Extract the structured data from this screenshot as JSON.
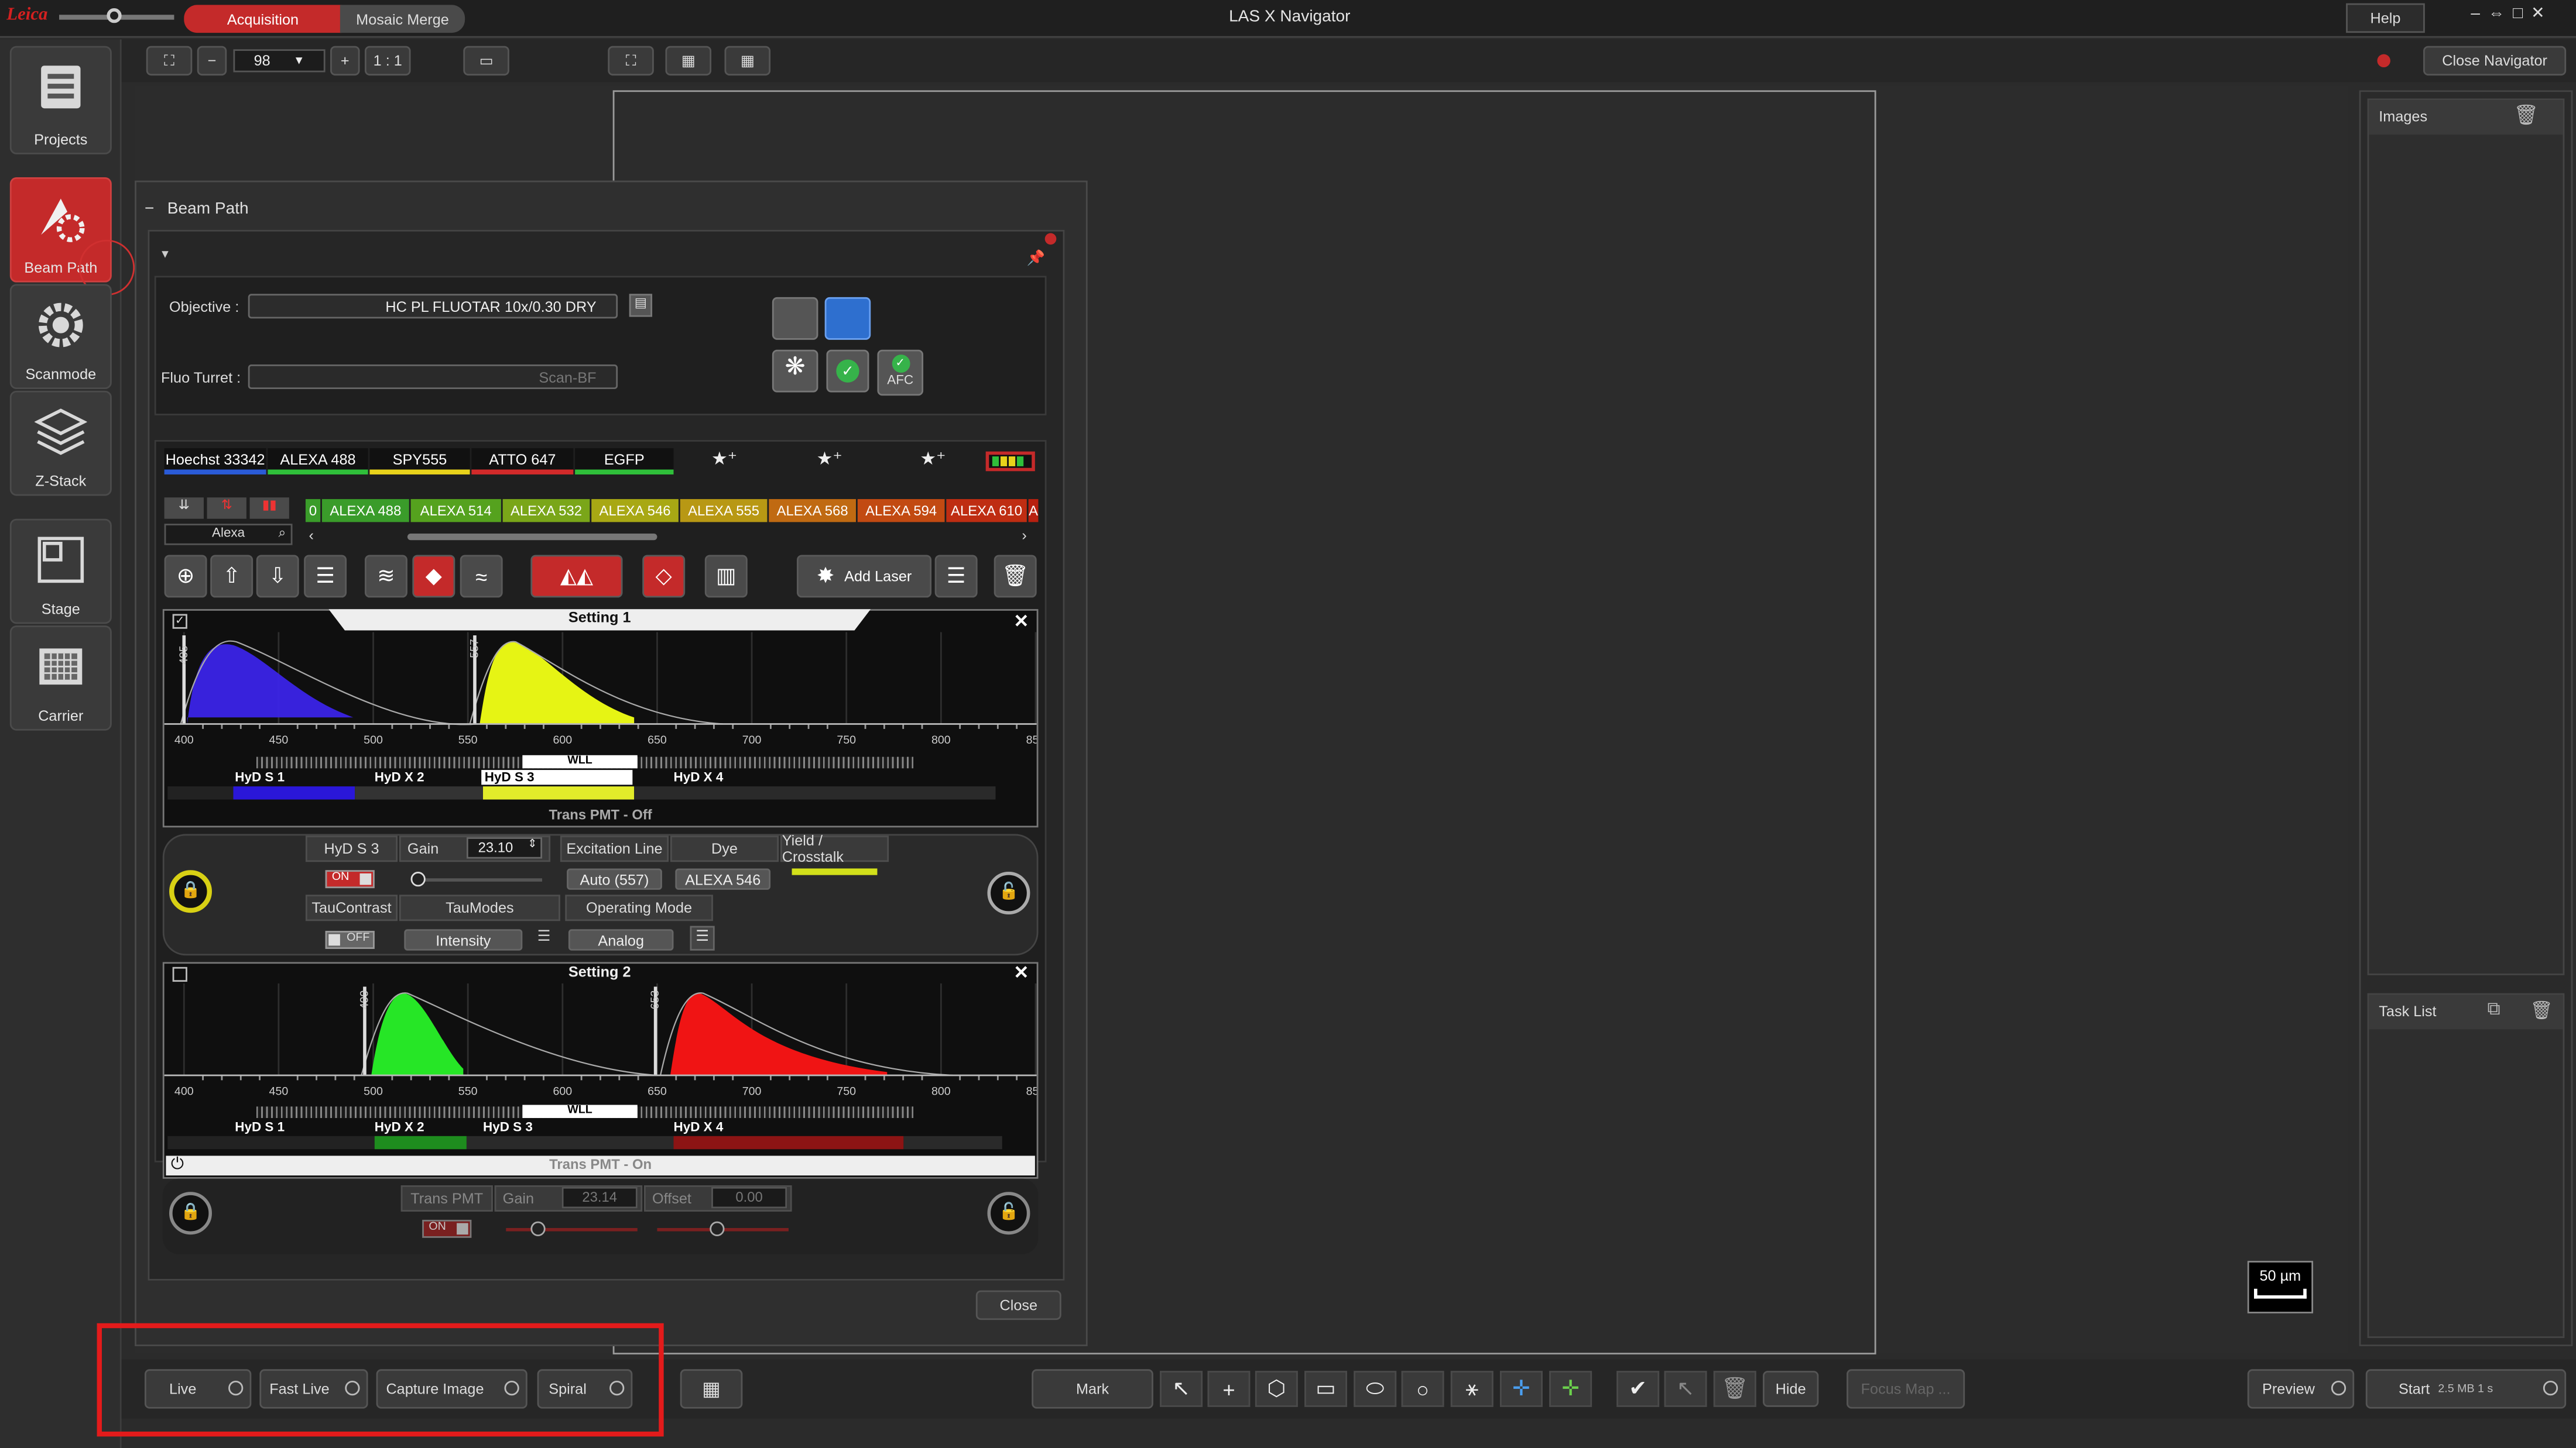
{
  "titlebar": {
    "title": "LAS X Navigator",
    "tabs": [
      "Acquisition",
      "Mosaic Merge"
    ],
    "help": "Help"
  },
  "toolbar": {
    "zoom": "98",
    "ratio": "1 : 1",
    "close_navigator": "Close Navigator"
  },
  "sidebar": [
    "Projects",
    "Beam Path",
    "Scanmode",
    "Z-Stack",
    "Stage",
    "Carrier"
  ],
  "right_panel": {
    "images": "Images",
    "task_list": "Task List"
  },
  "scale_bar": "50 µm",
  "beam_path": {
    "title": "Beam Path",
    "objective_label": "Objective :",
    "objective_value": "HC PL FLUOTAR    10x/0.30 DRY",
    "fluo_label": "Fluo Turret :",
    "fluo_value": "Scan-BF",
    "afc": "AFC",
    "dye_tabs": [
      {
        "name": "Hoechst 33342",
        "color": "#2a5bd7"
      },
      {
        "name": "ALEXA 488",
        "color": "#2fbf3a"
      },
      {
        "name": "SPY555",
        "color": "#e8d21b"
      },
      {
        "name": "ATTO 647",
        "color": "#d22a2a"
      },
      {
        "name": "EGFP",
        "color": "#2fbf3a"
      }
    ],
    "dye_chips": [
      {
        "name": "0",
        "color": "#3a9c2a"
      },
      {
        "name": "ALEXA 488",
        "color": "#3a9c2a"
      },
      {
        "name": "ALEXA 514",
        "color": "#55a21e"
      },
      {
        "name": "ALEXA 532",
        "color": "#7aa619"
      },
      {
        "name": "ALEXA 546",
        "color": "#a8a814"
      },
      {
        "name": "ALEXA 555",
        "color": "#b89814"
      },
      {
        "name": "ALEXA 568",
        "color": "#c06a12"
      },
      {
        "name": "ALEXA 594",
        "color": "#c24a12"
      },
      {
        "name": "ALEXA 610",
        "color": "#bf2d12"
      },
      {
        "name": "A",
        "color": "#b82010"
      }
    ],
    "dye_search": "Alexa",
    "add_laser": "Add Laser",
    "close": "Close",
    "axis_ticks": [
      "400",
      "450",
      "500",
      "550",
      "600",
      "650",
      "700",
      "750",
      "800",
      "850"
    ],
    "setting1": {
      "title": "Setting 1",
      "wll": "WLL",
      "lines": [
        "405",
        "557"
      ],
      "detectors": [
        "HyD S 1",
        "HyD X 2",
        "HyD S 3",
        "HyD X 4"
      ],
      "trans": "Trans PMT - Off",
      "hyd_label": "HyD S 3",
      "gain_label": "Gain",
      "gain": "23.10",
      "on": "ON",
      "exc_label": "Excitation Line",
      "exc_value": "Auto (557)",
      "dye_label": "Dye",
      "dye_value": "ALEXA 546",
      "yield_label": "Yield / Crosstalk",
      "tau_label": "TauContrast",
      "tau_value": "OFF",
      "taumodes_label": "TauModes",
      "taumodes_value": "Intensity",
      "opmode_label": "Operating Mode",
      "opmode_value": "Analog"
    },
    "setting2": {
      "title": "Setting 2",
      "wll": "WLL",
      "lines": [
        "499",
        "653"
      ],
      "detectors": [
        "HyD S 1",
        "HyD X 2",
        "HyD S 3",
        "HyD X 4"
      ],
      "trans": "Trans PMT - On",
      "trans_label": "Trans PMT",
      "gain_label": "Gain",
      "gain": "23.14",
      "offset_label": "Offset",
      "offset": "0.00",
      "on": "ON"
    }
  },
  "bottom": {
    "live": "Live",
    "fast_live": "Fast Live",
    "capture": "Capture Image",
    "spiral": "Spiral",
    "mark": "Mark",
    "hide": "Hide",
    "focus_map": "Focus Map ...",
    "preview": "Preview",
    "start": "Start",
    "start_info": "2.5 MB   1 s"
  }
}
